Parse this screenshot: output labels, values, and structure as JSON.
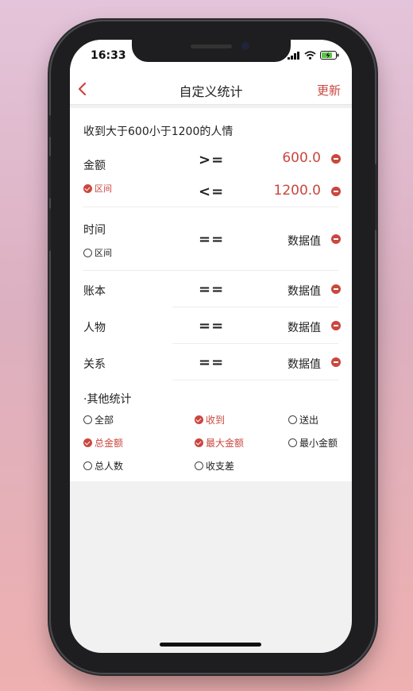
{
  "status": {
    "time": "16:33"
  },
  "nav": {
    "title": "自定义统计",
    "action": "更新"
  },
  "summary": "收到大于600小于1200的人情",
  "amount": {
    "label": "金额",
    "range_option": "区间",
    "op_min": ">=",
    "min_value": "600.0",
    "op_max": "<=",
    "max_value": "1200.0"
  },
  "time_row": {
    "label": "时间",
    "range_option": "区间",
    "op": "==",
    "value": "数据值"
  },
  "rows": [
    {
      "label": "账本",
      "op": "==",
      "value": "数据值"
    },
    {
      "label": "人物",
      "op": "==",
      "value": "数据值"
    },
    {
      "label": "关系",
      "op": "==",
      "value": "数据值"
    }
  ],
  "other": {
    "title": "·其他统计",
    "options": [
      {
        "label": "全部",
        "checked": false
      },
      {
        "label": "收到",
        "checked": true
      },
      {
        "label": "送出",
        "checked": false
      },
      {
        "label": "总金额",
        "checked": true
      },
      {
        "label": "最大金额",
        "checked": true
      },
      {
        "label": "最小金额",
        "checked": false
      },
      {
        "label": "总人数",
        "checked": false
      },
      {
        "label": "收支差",
        "checked": false
      }
    ]
  },
  "colors": {
    "accent": "#c9473f",
    "background": "#f1f1f1"
  },
  "icons": [
    "back-chevron-icon",
    "signal-icon",
    "wifi-icon",
    "battery-charging-icon",
    "remove-icon",
    "checkbox-checked-icon",
    "radio-unchecked-icon"
  ]
}
